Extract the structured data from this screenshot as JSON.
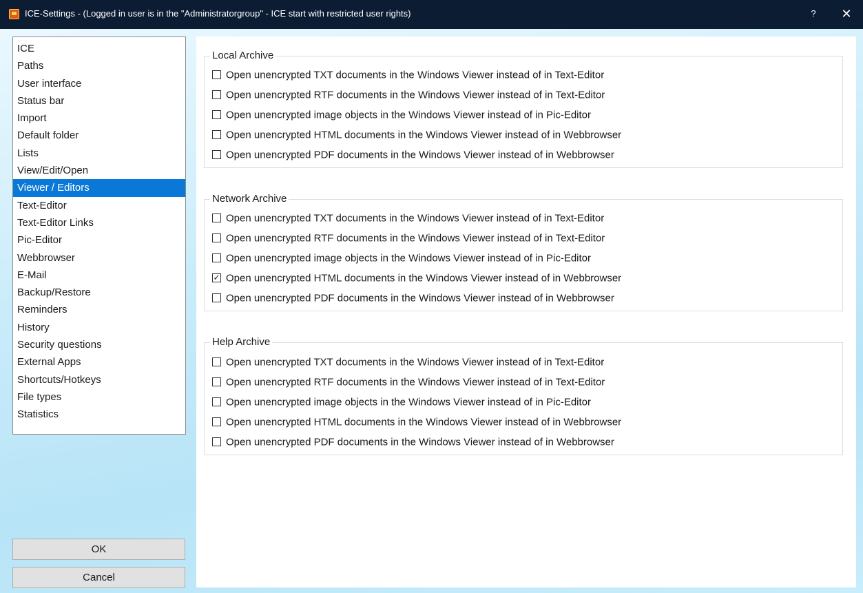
{
  "window": {
    "title": "ICE-Settings - (Logged in user is in the \"Administratorgroup\" - ICE start with restricted user rights)",
    "help_label": "?",
    "close_label": "✕"
  },
  "nav": {
    "items": [
      {
        "label": "ICE"
      },
      {
        "label": "Paths"
      },
      {
        "label": "User interface"
      },
      {
        "label": "Status bar"
      },
      {
        "label": "Import"
      },
      {
        "label": "Default folder"
      },
      {
        "label": "Lists"
      },
      {
        "label": "View/Edit/Open"
      },
      {
        "label": "Viewer / Editors"
      },
      {
        "label": "Text-Editor"
      },
      {
        "label": "Text-Editor Links"
      },
      {
        "label": "Pic-Editor"
      },
      {
        "label": "Webbrowser"
      },
      {
        "label": "E-Mail"
      },
      {
        "label": "Backup/Restore"
      },
      {
        "label": "Reminders"
      },
      {
        "label": "History"
      },
      {
        "label": "Security questions"
      },
      {
        "label": "External Apps"
      },
      {
        "label": "Shortcuts/Hotkeys"
      },
      {
        "label": "File types"
      },
      {
        "label": "Statistics"
      }
    ],
    "selected_label": "Viewer / Editors"
  },
  "buttons": {
    "ok": "OK",
    "cancel": "Cancel"
  },
  "groups": [
    {
      "title": "Local Archive",
      "options": [
        {
          "label": "Open unencrypted TXT documents in the Windows Viewer instead of in Text-Editor",
          "checked": false
        },
        {
          "label": "Open unencrypted RTF documents in the Windows Viewer instead of in Text-Editor",
          "checked": false
        },
        {
          "label": "Open unencrypted image objects in the Windows Viewer instead of in Pic-Editor",
          "checked": false
        },
        {
          "label": "Open unencrypted HTML documents in the Windows Viewer instead of in Webbrowser",
          "checked": false
        },
        {
          "label": "Open unencrypted PDF documents in the Windows Viewer instead of in Webbrowser",
          "checked": false
        }
      ]
    },
    {
      "title": "Network Archive",
      "options": [
        {
          "label": "Open unencrypted TXT documents in the Windows Viewer instead of in Text-Editor",
          "checked": false
        },
        {
          "label": "Open unencrypted RTF documents in the Windows Viewer instead of in Text-Editor",
          "checked": false
        },
        {
          "label": "Open unencrypted image objects in the Windows Viewer instead of in Pic-Editor",
          "checked": false
        },
        {
          "label": "Open unencrypted HTML documents in the Windows Viewer instead of in Webbrowser",
          "checked": true
        },
        {
          "label": "Open unencrypted PDF documents in the Windows Viewer instead of in Webbrowser",
          "checked": false
        }
      ]
    },
    {
      "title": "Help Archive",
      "options": [
        {
          "label": "Open unencrypted TXT documents in the Windows Viewer instead of in Text-Editor",
          "checked": false
        },
        {
          "label": "Open unencrypted RTF documents in the Windows Viewer instead of in Text-Editor",
          "checked": false
        },
        {
          "label": "Open unencrypted image objects in the Windows Viewer instead of in Pic-Editor",
          "checked": false
        },
        {
          "label": "Open unencrypted HTML documents in the Windows Viewer instead of in Webbrowser",
          "checked": false
        },
        {
          "label": "Open unencrypted PDF documents in the Windows Viewer instead of in Webbrowser",
          "checked": false
        }
      ]
    }
  ],
  "colors": {
    "titlebar": "#0b1c33",
    "selection": "#0a78d7",
    "background": "#c9ecfa"
  },
  "icons": {
    "app": "app-icon",
    "help": "help-icon",
    "close": "close-icon",
    "check": "checkmark-icon"
  }
}
